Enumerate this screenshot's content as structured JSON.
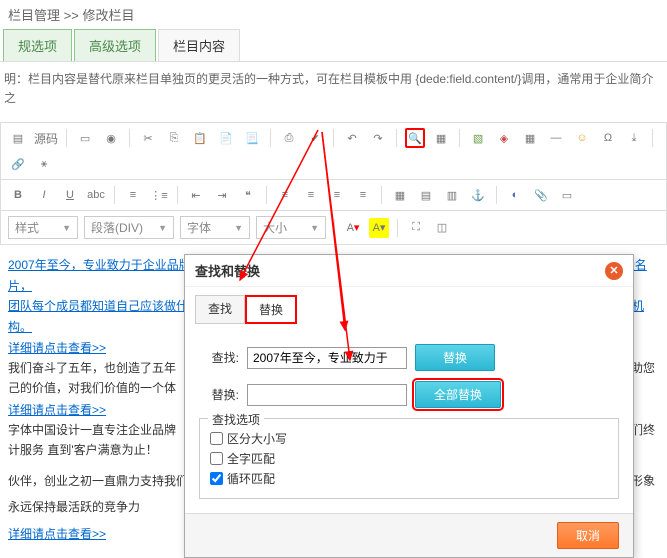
{
  "breadcrumb": {
    "a": "栏目管理",
    "sep": ">>",
    "b": "修改栏目"
  },
  "tabs": {
    "t1": "规选项",
    "t2": "高级选项",
    "t3": "栏目内容"
  },
  "desc": "明：栏目内容是替代原来栏目单独页的更灵活的一种方式，可在栏目模板中用 {dede:field.content/}调用，通常用于企业简介之",
  "tbar": {
    "src": "源码",
    "b": "B",
    "i": "I",
    "u": "U",
    "sel_style": "样式",
    "sel_block": "段落(DIV)",
    "sel_font": "字体",
    "sel_size": "大小"
  },
  "content": {
    "p1": "2007年至今，专业致力于企业品牌设计，一直以来，字体中国用实力作品，证明我们的设计作品。小到一个字体，一张名片，",
    "p2": "团队每个成员都知道自己应该做什么！又需要做什么！今年技术的开发每个人做到全业分工，所以成就了今天多下设计机构。",
    "link1": "详细请点击查看>>",
    "p3a": "我们奋斗了五年，也创造了五年",
    "p3b": "无止境，在帮助您",
    "p4": "己的价值，对我们价值的一个体",
    "link2": "详细请点击查看>>",
    "p5": "字体中国设计一直专注企业品牌",
    "p5b": "是的设计成品我们终",
    "p6": "计服务 直到'客户满意为止！",
    "p7": "伙伴，创业之初一直鼎力支持我们",
    "p7b": "的改变提升您的形象",
    "p8": "永远保持最活跃的竞争力",
    "link3": "详细请点击查看>>"
  },
  "dialog": {
    "title": "查找和替换",
    "tab_find": "查找",
    "tab_replace": "替换",
    "lbl_find": "查找:",
    "lbl_replace": "替换:",
    "val_find": "2007年至今，专业致力于",
    "val_replace": "",
    "btn_replace": "替换",
    "btn_replace_all": "全部替换",
    "opts_title": "查找选项",
    "opt_case": "区分大小写",
    "opt_whole": "全字匹配",
    "opt_loop": "循环匹配",
    "btn_cancel": "取消"
  }
}
